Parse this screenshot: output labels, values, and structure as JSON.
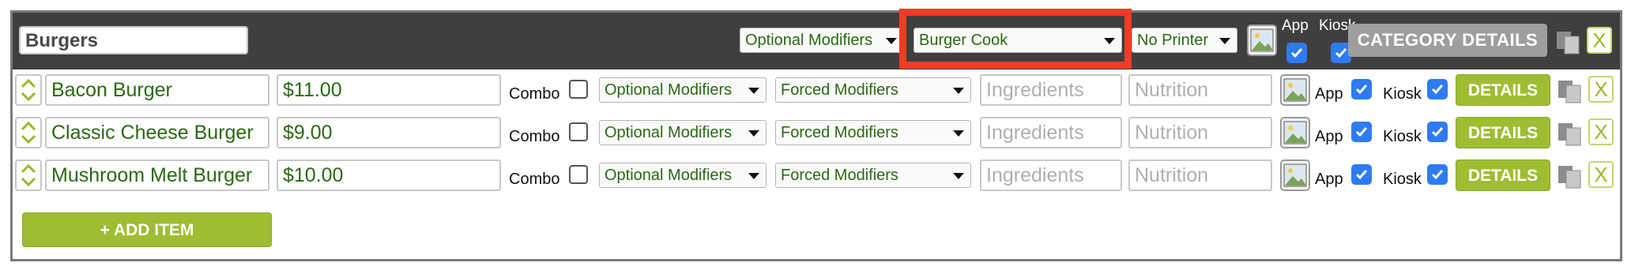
{
  "category": {
    "name": "Burgers",
    "optional_modifiers": "Optional Modifiers",
    "cook": "Burger Cook",
    "printer": "No Printer",
    "app_label": "App",
    "kiosk_label": "Kiosk",
    "app_checked": true,
    "kiosk_checked": true,
    "details_button": "CATEGORY DETAILS",
    "close_button": "X"
  },
  "item_labels": {
    "combo": "Combo",
    "app": "App",
    "kiosk": "Kiosk",
    "details": "DETAILS",
    "remove": "X",
    "ingredients_placeholder": "Ingredients",
    "nutrition_placeholder": "Nutrition"
  },
  "items": [
    {
      "name": "Bacon Burger",
      "price": "$11.00",
      "combo": false,
      "optional": "Optional Modifiers",
      "forced": "Forced Modifiers",
      "app": true,
      "kiosk": true
    },
    {
      "name": "Classic Cheese Burger",
      "price": "$9.00",
      "combo": false,
      "optional": "Optional Modifiers",
      "forced": "Forced Modifiers",
      "app": true,
      "kiosk": true
    },
    {
      "name": "Mushroom Melt Burger",
      "price": "$10.00",
      "combo": false,
      "optional": "Optional Modifiers",
      "forced": "Forced Modifiers",
      "app": true,
      "kiosk": true
    }
  ],
  "add_item_button": "+ ADD ITEM",
  "colors": {
    "header_bg": "#3f3f3f",
    "highlight": "#ee3d24",
    "accent_green": "#9fbd33",
    "checkbox_blue": "#2f7bf5",
    "text_green": "#2a6a13"
  }
}
